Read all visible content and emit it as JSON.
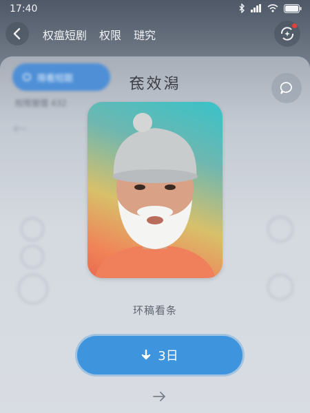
{
  "status_bar": {
    "time": "17:40"
  },
  "top_nav": {
    "tabs": [
      "权瘟短剧",
      "权限",
      "琎究"
    ]
  },
  "background": {
    "chip_label": "限看短题",
    "info_line": "权限管理   432"
  },
  "popup": {
    "title": "奃效潟",
    "caption": "环稿看条",
    "download_label": "3日"
  },
  "colors": {
    "accent": "#3f95dd",
    "notification_dot": "#e0413a"
  }
}
